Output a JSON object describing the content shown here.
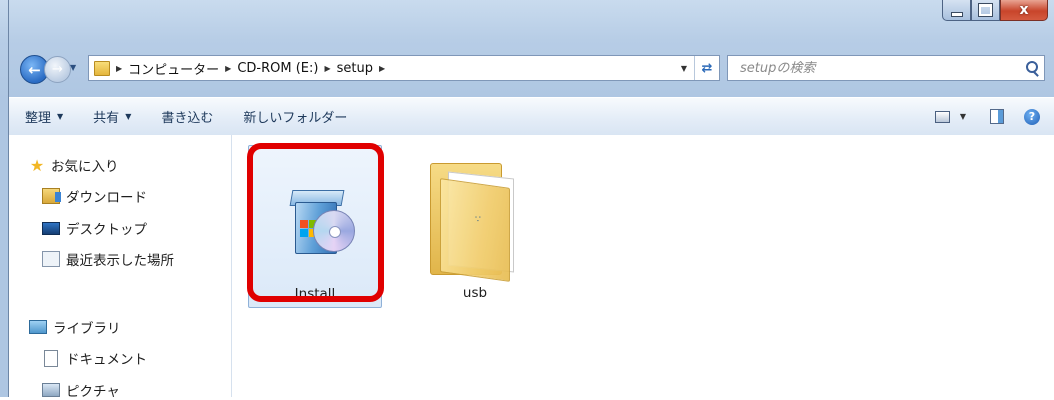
{
  "window": {
    "caption": {
      "minimize": "",
      "maximize": "",
      "close": "x"
    }
  },
  "address_bar": {
    "breadcrumbs": [
      "コンピューター",
      "CD-ROM (E:)",
      "setup"
    ]
  },
  "search": {
    "placeholder": "setupの検索"
  },
  "toolbar": {
    "items": [
      {
        "label": "整理",
        "has_dropdown": true
      },
      {
        "label": "共有",
        "has_dropdown": true
      },
      {
        "label": "書き込む",
        "has_dropdown": false
      },
      {
        "label": "新しいフォルダー",
        "has_dropdown": false
      }
    ],
    "help": "?"
  },
  "navigation_pane": {
    "items": [
      {
        "label": "お気に入り",
        "icon": "star-icon"
      },
      {
        "label": "ダウンロード",
        "icon": "downloads-folder-icon"
      },
      {
        "label": "デスクトップ",
        "icon": "desktop-icon"
      },
      {
        "label": "最近表示した場所",
        "icon": "recent-places-icon"
      },
      {
        "label": "ライブラリ",
        "icon": "library-icon"
      },
      {
        "label": "ドキュメント",
        "icon": "document-icon"
      },
      {
        "label": "ピクチャ",
        "icon": "pictures-icon"
      }
    ]
  },
  "files": [
    {
      "name": "Install",
      "icon": "installer-icon",
      "selected": true,
      "highlighted": true,
      "highlight_color": "#e00000"
    },
    {
      "name": "usb",
      "icon": "folder-icon",
      "selected": false
    }
  ]
}
